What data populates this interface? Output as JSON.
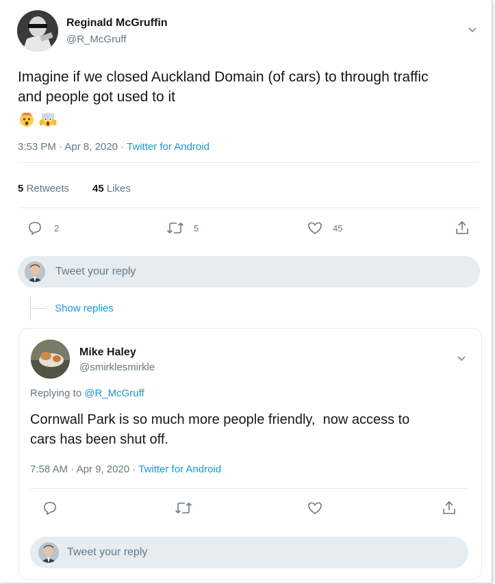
{
  "tweet": {
    "author_name": "Reginald McGruffin",
    "author_handle": "@R_McGruff",
    "text_line1": "Imagine if we closed Auckland Domain (of cars) to through traffic",
    "text_line2": "and people got used to it",
    "emojis": [
      "exploding-head",
      "face-screaming"
    ],
    "time": "3:53 PM",
    "date": "Apr 8, 2020",
    "source": "Twitter for Android",
    "retweets_count": "5",
    "retweets_label": "Retweets",
    "likes_count": "45",
    "likes_label": "Likes",
    "action_reply_count": "2",
    "action_retweet_count": "5",
    "action_like_count": "45"
  },
  "reply_box_1": {
    "placeholder": "Tweet your reply"
  },
  "show_replies": "Show replies",
  "reply_tweet": {
    "author_name": "Mike Haley",
    "author_handle": "@smirklesmirkle",
    "replying_to_label": "Replying to",
    "replying_to_handle": "@R_McGruff",
    "text_line1": "Cornwall Park is so much more people friendly,  now access to",
    "text_line2": "cars has been shut off.",
    "time": "7:58 AM",
    "date": "Apr 9, 2020",
    "source": "Twitter for Android"
  },
  "reply_box_2": {
    "placeholder": "Tweet your reply"
  },
  "separator": "·",
  "colors": {
    "link": "#1b95e0",
    "muted": "#657786",
    "reply_bg": "#e6ecf0"
  }
}
